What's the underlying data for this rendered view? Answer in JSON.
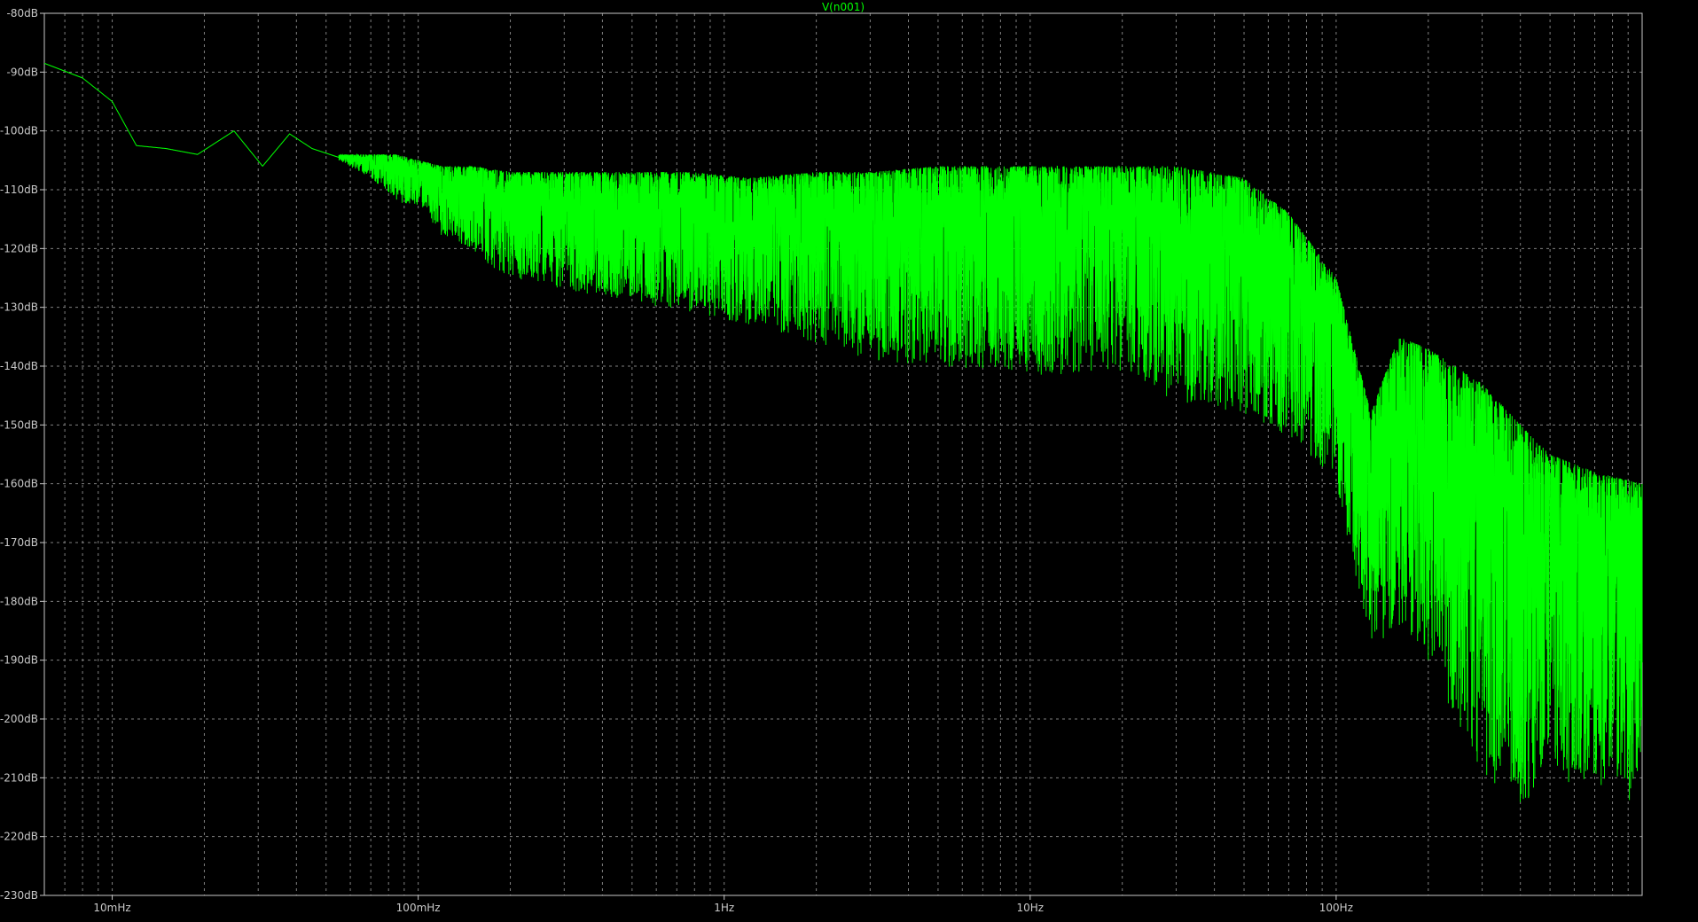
{
  "chart_data": {
    "type": "line",
    "title": "V(n001)",
    "xlabel": "",
    "ylabel": "",
    "x_scale": "log",
    "xlim": [
      0.006,
      1000
    ],
    "ylim": [
      -230,
      -80
    ],
    "grid": true,
    "background": "#000000",
    "grid_color": "#808080",
    "trace_color": "#00ff00",
    "y_ticks": [
      "-80dB",
      "-90dB",
      "-100dB",
      "-110dB",
      "-120dB",
      "-130dB",
      "-140dB",
      "-150dB",
      "-160dB",
      "-170dB",
      "-180dB",
      "-190dB",
      "-200dB",
      "-210dB",
      "-220dB",
      "-230dB"
    ],
    "y_tick_values": [
      -80,
      -90,
      -100,
      -110,
      -120,
      -130,
      -140,
      -150,
      -160,
      -170,
      -180,
      -190,
      -200,
      -210,
      -220,
      -230
    ],
    "x_ticks": [
      "10mHz",
      "100mHz",
      "1Hz",
      "10Hz",
      "100Hz"
    ],
    "x_tick_values": [
      0.01,
      0.1,
      1,
      10,
      100
    ],
    "series": [
      {
        "name": "V(n001)",
        "x": [
          0.006,
          0.008,
          0.01,
          0.012,
          0.015,
          0.019,
          0.025,
          0.031,
          0.038,
          0.045,
          0.055,
          0.07,
          0.085,
          0.1,
          0.12,
          0.15,
          0.2,
          0.3,
          0.5,
          0.8,
          1.2,
          2,
          3,
          5,
          8,
          12,
          20,
          30,
          50,
          70,
          100,
          130,
          160,
          200,
          300,
          400,
          500,
          700,
          1000
        ],
        "envelope_upper": [
          -88.5,
          -91,
          -95,
          -102.5,
          -103,
          -104,
          -100,
          -106,
          -100.5,
          -103,
          -104,
          -104,
          -104,
          -105,
          -106,
          -106,
          -107,
          -107,
          -107,
          -107,
          -108,
          -107,
          -107,
          -106,
          -106,
          -106,
          -106,
          -106,
          -108,
          -114,
          -125,
          -148,
          -135,
          -137,
          -143,
          -150,
          -155,
          -158,
          -160
        ],
        "envelope_lower": [
          -88.5,
          -91,
          -95,
          -102.5,
          -103,
          -104,
          -100,
          -106,
          -100.5,
          -103,
          -105,
          -108,
          -112,
          -113,
          -118,
          -121,
          -125,
          -127,
          -129,
          -131,
          -133,
          -136,
          -139,
          -140,
          -141,
          -142,
          -141,
          -146,
          -148,
          -152,
          -160,
          -188,
          -185,
          -190,
          -210,
          -215,
          -210,
          -212,
          -215
        ],
        "mean": [
          -88.5,
          -91,
          -95,
          -102.5,
          -103,
          -104,
          -100,
          -106,
          -100.5,
          -103,
          -104.5,
          -105,
          -107,
          -108,
          -111,
          -112,
          -114,
          -115,
          -115,
          -115,
          -115,
          -114,
          -114,
          -114,
          -113,
          -113,
          -113,
          -113,
          -116,
          -123,
          -136,
          -165,
          -148,
          -160,
          -170,
          -180,
          -180,
          -185,
          -190
        ]
      }
    ]
  }
}
